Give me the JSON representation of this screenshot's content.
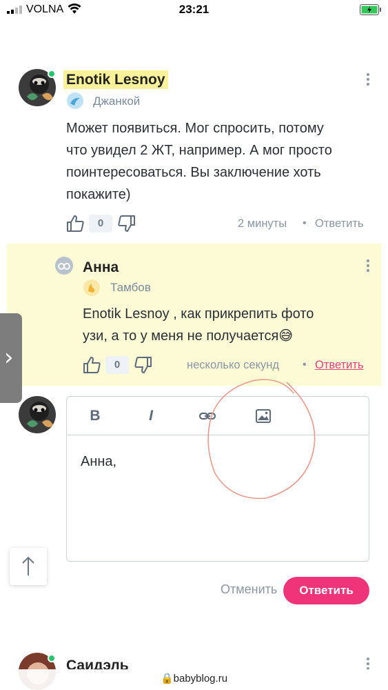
{
  "status_bar": {
    "carrier": "VOLNA",
    "time": "23:21"
  },
  "comments": [
    {
      "author": "Enotik Lesnoy",
      "location": "Джанкой",
      "text_lines": [
        "Может появиться. Мог спросить, потому",
        "что увидел 2 ЖТ, например. А мог просто",
        "поинтересоваться. Вы заключение хоть",
        "покажите)"
      ],
      "likes": "0",
      "time": "2 минуты",
      "separator": "•",
      "reply_label": "Ответить"
    },
    {
      "author": "Анна",
      "location": "Тамбов",
      "text_lines": [
        "Enotik Lesnoy , как прикрепить фото",
        "узи, а то у меня не получается😅"
      ],
      "likes": "0",
      "time": "несколько секунд",
      "separator": "•",
      "reply_label": "Ответить"
    }
  ],
  "editor": {
    "toolbar": {
      "bold": "B",
      "italic": "I"
    },
    "text": "Анна,",
    "cancel_label": "Отменить",
    "submit_label": "Ответить"
  },
  "next_comment": {
    "author": "Саидэль"
  },
  "browser": {
    "url": "babyblog.ru"
  },
  "colors": {
    "accent": "#f0347a",
    "highlight": "#f9f29a",
    "reply_bg": "#fcfbd6",
    "online": "#27c46b"
  }
}
